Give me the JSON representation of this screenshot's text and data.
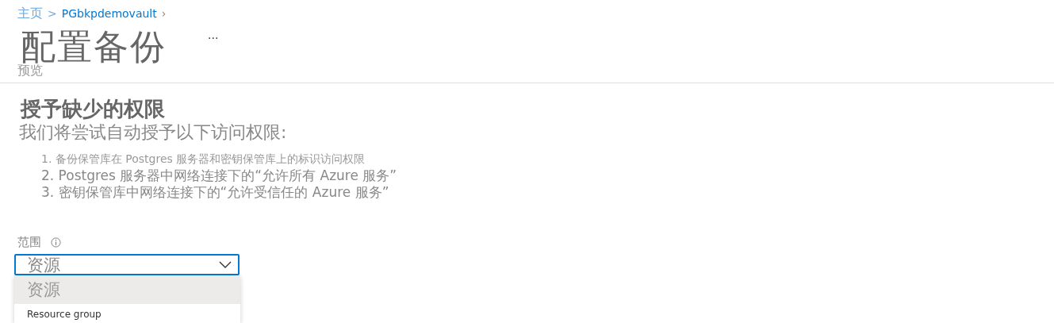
{
  "breadcrumb": [
    {
      "label": "主页",
      "separator": ">"
    },
    {
      "label": "PGbkpdemovault",
      "separator": "›"
    }
  ],
  "page": {
    "title": "配置备份",
    "more": "...",
    "subtitle": "预览"
  },
  "section": {
    "heading": "授予缺少的权限",
    "intro": "我们将尝试自动授予以下访问权限:",
    "items": [
      {
        "text": "1. 备份保管库在 Postgres 服务器和密钥保管库上的标识访问权限",
        "kind": "small"
      },
      {
        "text": "2. Postgres 服务器中网络连接下的“允许所有 Azure 服务”",
        "kind": "large"
      },
      {
        "text": "3. 密钥保管库中网络连接下的“允许受信任的 Azure 服务”",
        "kind": "large"
      }
    ]
  },
  "scope": {
    "label": "范围",
    "value": "资源",
    "expanded": true,
    "options": [
      {
        "label": "资源",
        "selected": true
      },
      {
        "label": "Resource group",
        "selected": false
      }
    ]
  }
}
